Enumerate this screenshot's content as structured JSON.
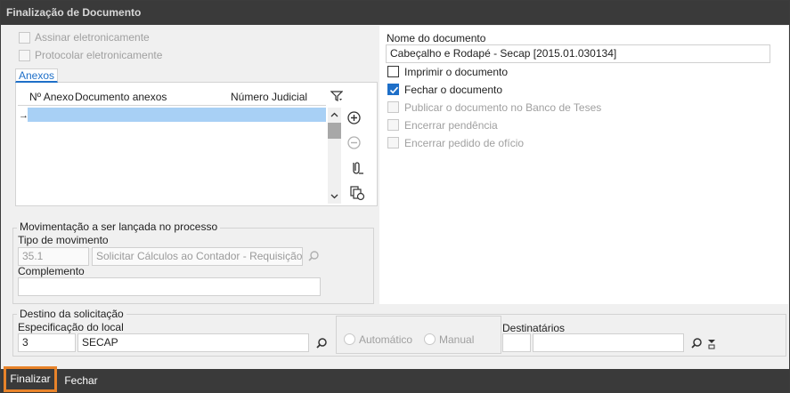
{
  "window": {
    "title": "Finalização de Documento"
  },
  "options_left": {
    "assinar": "Assinar eletronicamente",
    "protocolar": "Protocolar eletronicamente"
  },
  "tabs": [
    {
      "label": "Anexos"
    }
  ],
  "anexos_grid": {
    "columns": [
      "Nº Anexo",
      "Documento anexos",
      "Número Judicial"
    ],
    "rows": [
      {
        "indicator": "→"
      }
    ]
  },
  "movimentacao": {
    "legend": "Movimentação a ser lançada no processo",
    "tipo_label": "Tipo de movimento",
    "tipo_code": "35.1",
    "tipo_desc": "Solicitar Cálculos ao Contador - Requisição de",
    "complemento_label": "Complemento",
    "complemento_value": ""
  },
  "documento": {
    "nome_label": "Nome do documento",
    "nome_value": "Cabeçalho e Rodapé - Secap [2015.01.030134]",
    "imprimir": "Imprimir o documento",
    "fechar": "Fechar o documento",
    "publicar": "Publicar o documento no Banco de Teses",
    "encerrar_pendencia": "Encerrar pendência",
    "encerrar_pedido": "Encerrar pedido de ofício"
  },
  "destino": {
    "legend": "Destino da solicitação",
    "local_label": "Especificação do local",
    "local_code": "3",
    "local_name": "SECAP",
    "automatico": "Automático",
    "manual": "Manual",
    "destinatarios_label": "Destinatários"
  },
  "footer": {
    "finalizar": "Finalizar",
    "fechar": "Fechar"
  },
  "colors": {
    "accent": "#1e6fc8",
    "highlight_row": "#a8d0f5",
    "focus_border": "#e8832a",
    "bar": "#3a3a3a"
  }
}
